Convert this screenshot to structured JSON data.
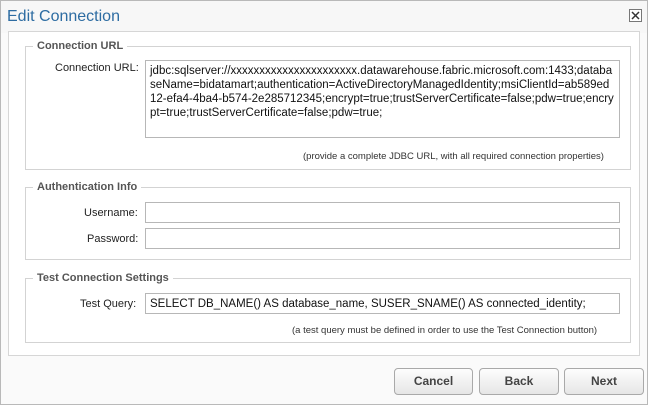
{
  "dialog": {
    "title": "Edit Connection"
  },
  "connection_url": {
    "legend": "Connection URL",
    "label": "Connection URL:",
    "value": "jdbc:sqlserver://xxxxxxxxxxxxxxxxxxxxxx.datawarehouse.fabric.microsoft.com:1433;databaseName=bidatamart;authentication=ActiveDirectoryManagedIdentity;msiClientId=ab589ed12-efa4-4ba4-b574-2e285712345;encrypt=true;trustServerCertificate=false;pdw=true;encrypt=true;trustServerCertificate=false;pdw=true;",
    "hint": "(provide a complete JDBC URL, with all required connection properties)"
  },
  "authentication": {
    "legend": "Authentication Info",
    "username_label": "Username:",
    "username_value": "",
    "password_label": "Password:",
    "password_value": ""
  },
  "test_connection": {
    "legend": "Test Connection Settings",
    "query_label": "Test Query:",
    "query_value": "SELECT DB_NAME() AS database_name, SUSER_SNAME() AS connected_identity;",
    "hint": "(a test query must be defined in order to use the Test Connection button)"
  },
  "buttons": {
    "cancel": "Cancel",
    "back": "Back",
    "next": "Next"
  }
}
